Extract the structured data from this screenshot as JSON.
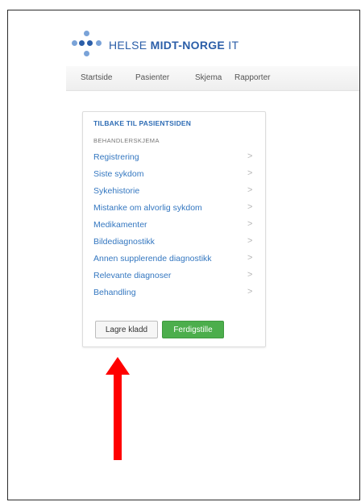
{
  "logo": {
    "text_light": "HELSE ",
    "text_bold": "MIDT-NORGE",
    "text_suffix": " IT",
    "dot_colors": [
      "#7aa3d8",
      "#2b5ea8"
    ]
  },
  "nav": {
    "items": [
      {
        "label": "Startside"
      },
      {
        "label": "Pasienter"
      },
      {
        "label": "Skjema"
      },
      {
        "label": "Rapporter"
      }
    ]
  },
  "panel": {
    "title": "TILBAKE TIL PASIENTSIDEN",
    "section": "BEHANDLERSKJEMA",
    "items": [
      {
        "label": "Registrering"
      },
      {
        "label": "Siste sykdom"
      },
      {
        "label": "Sykehistorie"
      },
      {
        "label": "Mistanke om alvorlig sykdom"
      },
      {
        "label": "Medikamenter"
      },
      {
        "label": "Bildediagnostikk"
      },
      {
        "label": "Annen supplerende diagnostikk"
      },
      {
        "label": "Relevante diagnoser"
      },
      {
        "label": "Behandling"
      }
    ],
    "chevron": ">",
    "buttons": {
      "draft": "Lagre kladd",
      "finish": "Ferdigstille"
    }
  },
  "colors": {
    "link": "#3477c0",
    "title": "#2f6db5",
    "finish_button": "#4cae4c",
    "arrow": "#ff0000"
  }
}
